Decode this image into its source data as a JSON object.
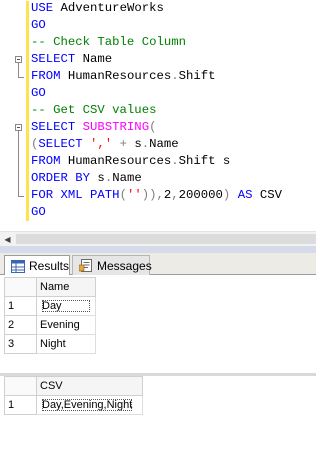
{
  "editor": {
    "lines": [
      [
        {
          "t": "USE ",
          "c": "kw"
        },
        {
          "t": "AdventureWorks",
          "c": "tx"
        }
      ],
      [
        {
          "t": "GO",
          "c": "kw"
        }
      ],
      [
        {
          "t": "-- Check Table Column",
          "c": "cm"
        }
      ],
      [
        {
          "t": "SELECT ",
          "c": "kw"
        },
        {
          "t": "Name",
          "c": "tx"
        }
      ],
      [
        {
          "t": "FROM ",
          "c": "kw"
        },
        {
          "t": "HumanResources",
          "c": "tx"
        },
        {
          "t": ".",
          "c": "op"
        },
        {
          "t": "Shift",
          "c": "tx"
        }
      ],
      [
        {
          "t": "GO",
          "c": "kw"
        }
      ],
      [
        {
          "t": "-- Get CSV values",
          "c": "cm"
        }
      ],
      [
        {
          "t": "SELECT ",
          "c": "kw"
        },
        {
          "t": "SUBSTRING",
          "c": "fn"
        },
        {
          "t": "(",
          "c": "op"
        }
      ],
      [
        {
          "t": "(",
          "c": "op"
        },
        {
          "t": "SELECT ",
          "c": "kw"
        },
        {
          "t": "','",
          "c": "str"
        },
        {
          "t": " + ",
          "c": "op"
        },
        {
          "t": "s",
          "c": "tx"
        },
        {
          "t": ".",
          "c": "op"
        },
        {
          "t": "Name",
          "c": "tx"
        }
      ],
      [
        {
          "t": "FROM ",
          "c": "kw"
        },
        {
          "t": "HumanResources",
          "c": "tx"
        },
        {
          "t": ".",
          "c": "op"
        },
        {
          "t": "Shift s",
          "c": "tx"
        }
      ],
      [
        {
          "t": "ORDER BY ",
          "c": "kw"
        },
        {
          "t": "s",
          "c": "tx"
        },
        {
          "t": ".",
          "c": "op"
        },
        {
          "t": "Name",
          "c": "tx"
        }
      ],
      [
        {
          "t": "FOR XML PATH",
          "c": "kw"
        },
        {
          "t": "(",
          "c": "op"
        },
        {
          "t": "''",
          "c": "str"
        },
        {
          "t": ")),",
          "c": "op"
        },
        {
          "t": "2",
          "c": "tx"
        },
        {
          "t": ",",
          "c": "op"
        },
        {
          "t": "200000",
          "c": "tx"
        },
        {
          "t": ") ",
          "c": "op"
        },
        {
          "t": "AS ",
          "c": "kw"
        },
        {
          "t": "CSV",
          "c": "tx"
        }
      ],
      [
        {
          "t": "GO",
          "c": "kw"
        }
      ]
    ]
  },
  "tabs": {
    "results_label": "Results",
    "messages_label": "Messages"
  },
  "grid1": {
    "column": "Name",
    "rows": [
      {
        "num": "1",
        "value": "Day"
      },
      {
        "num": "2",
        "value": "Evening"
      },
      {
        "num": "3",
        "value": "Night"
      }
    ]
  },
  "grid2": {
    "column": "CSV",
    "rows": [
      {
        "num": "1",
        "value": "Day,Evening,Night"
      }
    ]
  }
}
